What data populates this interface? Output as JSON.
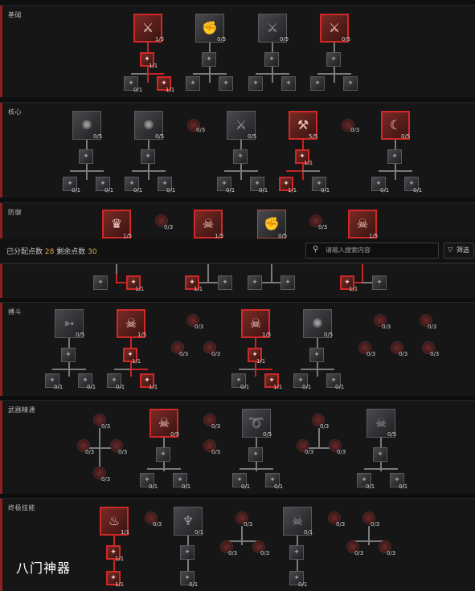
{
  "sections": {
    "basic": "基础",
    "core": "核心",
    "defense": "防御",
    "brawl": "搏斗",
    "weapon_mastery": "武器精通",
    "ultimate": "终极技能"
  },
  "topbar": {
    "allocated_label": "已分配点数",
    "allocated_value": "28",
    "remaining_label": "剩余点数",
    "remaining_value": "30",
    "search_placeholder": "请输入搜索内容",
    "filter_label": "筛选"
  },
  "icons": {
    "search": "search-icon",
    "filter": "filter-icon"
  },
  "colors": {
    "accent_red": "#c42424",
    "points_value": "#d7a94a"
  },
  "ranks": {
    "r15": "1/5",
    "r05": "0/5",
    "r55": "5/5",
    "r11": "1/1",
    "r01": "0/1",
    "r03": "0/3"
  },
  "watermark": "八门神器"
}
